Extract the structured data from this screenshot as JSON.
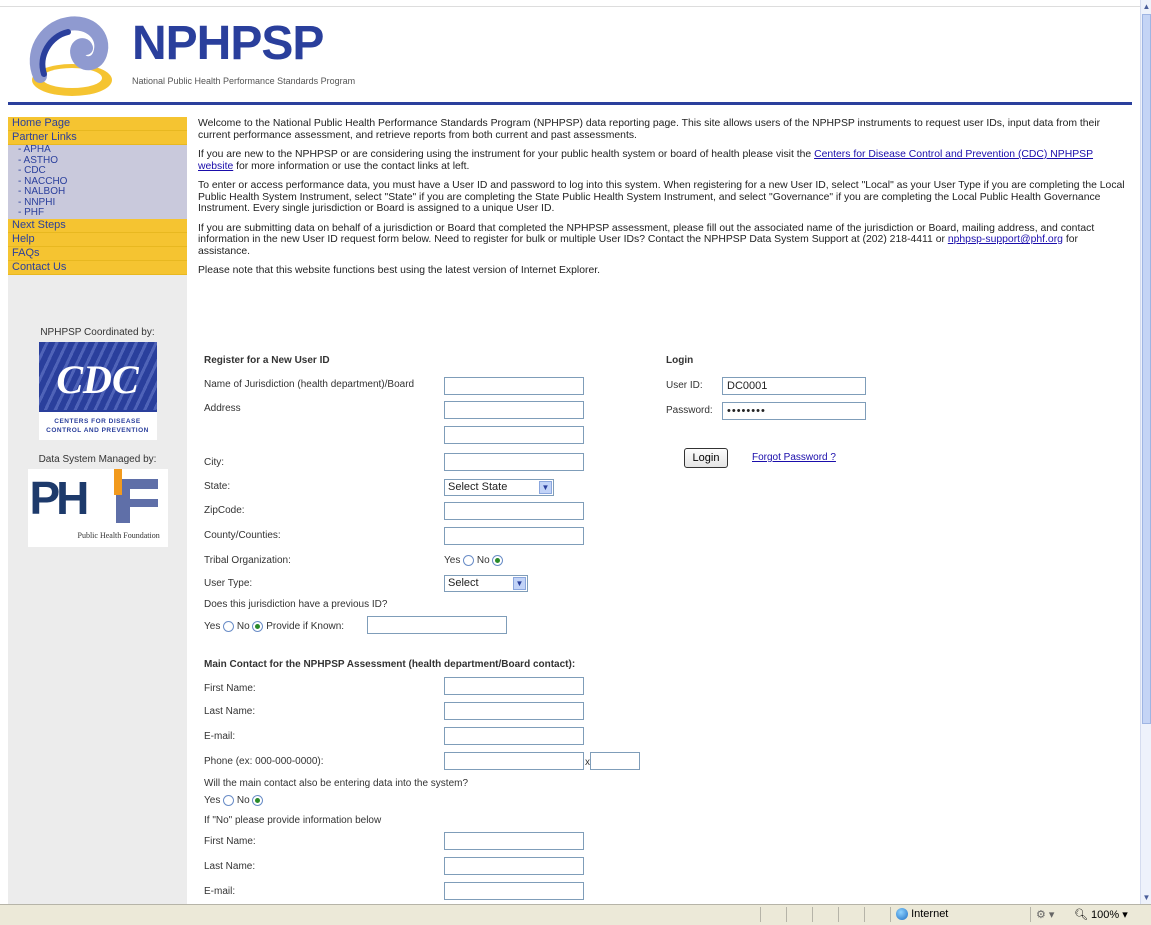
{
  "header": {
    "logo_text": "NPHPSP",
    "logo_subtitle": "National Public Health Performance Standards Program"
  },
  "sidebar": {
    "items": [
      {
        "label": "Home Page",
        "level": "main"
      },
      {
        "label": "Partner Links",
        "level": "main"
      },
      {
        "label": "- APHA",
        "level": "sub"
      },
      {
        "label": "- ASTHO",
        "level": "sub"
      },
      {
        "label": "- CDC",
        "level": "sub"
      },
      {
        "label": "- NACCHO",
        "level": "sub"
      },
      {
        "label": "- NALBOH",
        "level": "sub"
      },
      {
        "label": "- NNPHI",
        "level": "sub"
      },
      {
        "label": "- PHF",
        "level": "sub"
      },
      {
        "label": "Next Steps",
        "level": "main"
      },
      {
        "label": "Help",
        "level": "main"
      },
      {
        "label": "FAQs",
        "level": "main"
      },
      {
        "label": "Contact Us",
        "level": "main"
      }
    ],
    "coordinated_by": "NPHPSP Coordinated by:",
    "cdc_letters": "CDC",
    "cdc_line1": "CENTERS FOR DISEASE",
    "cdc_line2": "CONTROL AND PREVENTION",
    "managed_by": "Data System Managed by:",
    "phf_letters": "PH",
    "phf_caption": "Public Health Foundation"
  },
  "intro": {
    "p1": "Welcome to the National Public Health Performance Standards Program (NPHPSP) data reporting page. This site allows users of the NPHPSP instruments to request user IDs, input data from their current performance assessment, and retrieve reports from both current and past assessments.",
    "p2_before": "If you are new to the NPHPSP or are considering using the instrument for your public health system or board of health please visit the ",
    "p2_link": "Centers for Disease Control and Prevention (CDC) NPHPSP website",
    "p2_after": " for more information or use the contact links at left.",
    "p3": "To enter or access performance data, you must have a User ID and password to log into this system. When registering for a new User ID, select \"Local\" as your User Type if you are completing the Local Public Health System Instrument, select \"State\" if you are completing the State Public Health System Instrument, and select \"Governance\" if you are completing the Local Public Health Governance Instrument. Every single jurisdiction or Board is assigned to a unique User ID.",
    "p4_before": "If you are submitting data on behalf of a jurisdiction or Board that completed the NPHPSP assessment, please fill out the associated name of the jurisdiction or Board, mailing address, and contact information in the new User ID request form below. Need to register for bulk or multiple User IDs? Contact the NPHPSP Data System Support at (202) 218-4411 or ",
    "p4_link": "nphpsp-support@phf.org",
    "p4_after": " for assistance.",
    "p5": "Please note that this website functions best using the latest version of Internet Explorer."
  },
  "register": {
    "title": "Register for a New User ID",
    "jurisdiction_label": "Name of Jurisdiction (health department)/Board",
    "address_label": "Address",
    "city_label": "City:",
    "state_label": "State:",
    "state_value": "Select State",
    "zip_label": "ZipCode:",
    "county_label": "County/Counties:",
    "tribal_label": "Tribal Organization:",
    "yes": "Yes",
    "no": "No",
    "user_type_label": "User Type:",
    "user_type_value": "Select",
    "previous_id_question": "Does this jurisdiction have a previous ID?",
    "provide_if_known": "Provide if Known:",
    "main_contact_heading": "Main Contact for the NPHPSP Assessment (health department/Board contact):",
    "first_name": "First Name:",
    "last_name": "Last Name:",
    "email": "E-mail:",
    "phone": "Phone (ex: 000-000-0000):",
    "phone_ext": "x",
    "entering_data_question": "Will the main contact also be entering data into the system?",
    "if_no_note": "If \"No\" please provide information below"
  },
  "login": {
    "title": "Login",
    "user_id_label": "User ID:",
    "user_id_value": "DC0001",
    "password_label": "Password:",
    "password_value": "••••••••",
    "login_button": "Login",
    "forgot_password": "Forgot Password ?"
  },
  "statusbar": {
    "zone": "Internet",
    "zoom": "100%"
  },
  "colors": {
    "brand_blue": "#2a3f9c",
    "nav_yellow": "#f5c431",
    "nav_lavender": "#c9c9dc"
  }
}
